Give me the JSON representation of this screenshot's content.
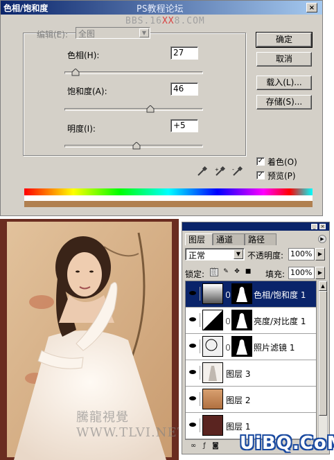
{
  "dialog": {
    "title": "色相/饱和度",
    "title_watermark": "PS教程论坛",
    "close_label": "×",
    "watermark_pre": "BBS.16",
    "watermark_red": "XX",
    "watermark_post": "8.COM",
    "edit_label": "编辑(E):",
    "edit_value": "全图",
    "hue": {
      "label": "色相(H):",
      "value": "27",
      "level": 0.08
    },
    "saturation": {
      "label": "饱和度(A):",
      "value": "46",
      "level": 0.62
    },
    "lightness": {
      "label": "明度(I):",
      "value": "+5",
      "level": 0.52
    },
    "buttons": {
      "ok": "确定",
      "cancel": "取消",
      "load": "载入(L)...",
      "save": "存储(S)..."
    },
    "colorize": {
      "label": "着色(O)",
      "checked": true
    },
    "preview": {
      "label": "预览(P)",
      "checked": true
    },
    "colors": {
      "titlebar": "#0a246a",
      "face": "#d4d0c8",
      "result_bar": "#b08050"
    }
  },
  "photo": {
    "watermark": "騰龍視覺WWW.TLVI.NET",
    "colors": {
      "frame": "#6a2c20",
      "background": "#d9b48c"
    }
  },
  "layers_panel": {
    "tabs": [
      "图层",
      "通道",
      "路径"
    ],
    "blend_mode": "正常",
    "opacity_label": "不透明度:",
    "opacity": "100%",
    "lock_label": "锁定:",
    "fill_label": "填充:",
    "fill": "100%",
    "layers": [
      {
        "name": "色相/饱和度 1",
        "selected": true
      },
      {
        "name": "亮度/对比度 1",
        "selected": false
      },
      {
        "name": "照片滤镜 1",
        "selected": false
      },
      {
        "name": "图层 3",
        "selected": false
      },
      {
        "name": "图层 2",
        "selected": false
      },
      {
        "name": "图层 1",
        "selected": false
      }
    ],
    "colors": {
      "selection": "#0a246a"
    }
  },
  "site_watermark": "UiBQ.CoM"
}
